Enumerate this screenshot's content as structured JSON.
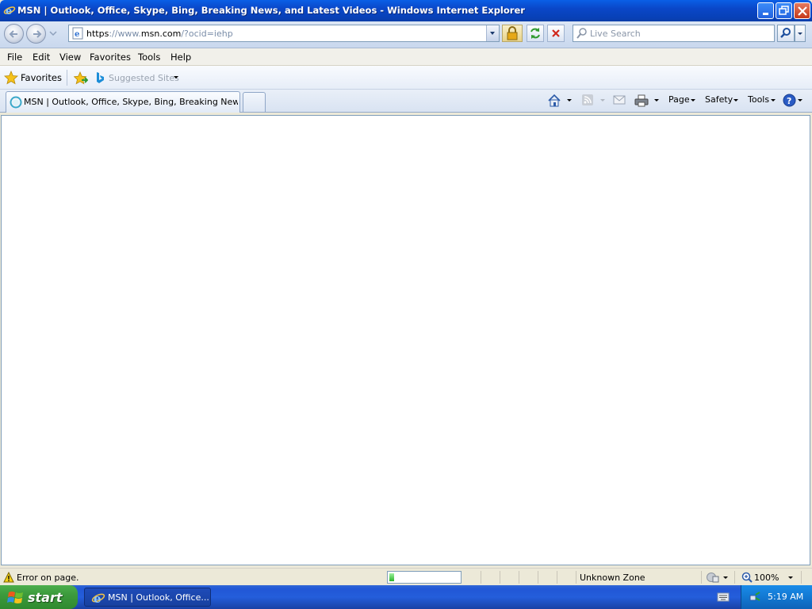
{
  "window": {
    "title": "MSN | Outlook, Office, Skype, Bing, Breaking News, and Latest Videos - Windows Internet Explorer"
  },
  "address": {
    "scheme": "https",
    "sep": "://",
    "www": "www.",
    "host": "msn.com",
    "path": "/?ocid=iehp"
  },
  "search": {
    "placeholder": "Live Search"
  },
  "menu": [
    "File",
    "Edit",
    "View",
    "Favorites",
    "Tools",
    "Help"
  ],
  "favorites_bar": {
    "favorites_label": "Favorites",
    "suggested_label": "Suggested Sites"
  },
  "tab": {
    "label": "MSN | Outlook, Office, Skype, Bing, Breaking News, a..."
  },
  "command_bar": {
    "page": "Page",
    "safety": "Safety",
    "tools": "Tools"
  },
  "status": {
    "message": "Error on page.",
    "progress": 0.07,
    "zone": "Unknown Zone",
    "zoom": "100%"
  },
  "taskbar": {
    "start_label": "start",
    "item_label": "MSN | Outlook, Office...",
    "clock": "5:19 AM"
  },
  "colors": {
    "titlebar": "#0A47C8",
    "taskbar": "#245EDB",
    "start_button": "#3C9A3C"
  }
}
